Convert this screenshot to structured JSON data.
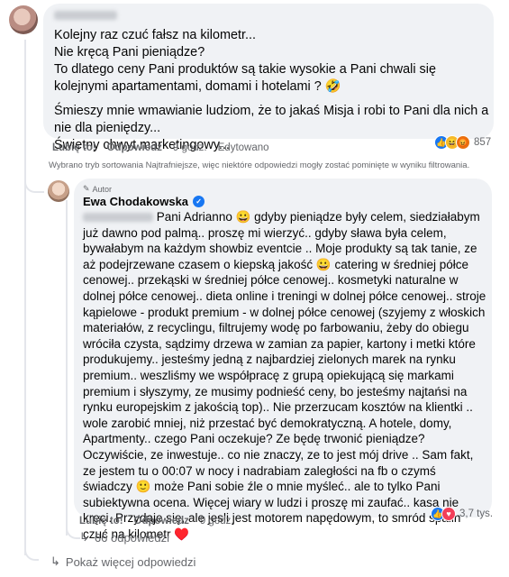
{
  "comment1": {
    "lines": [
      "Kolejny raz czuć fałsz na kilometr...\nNie kręcą Pani pieniądze?\nTo dlatego ceny Pani produktów są takie wysokie a Pani chwali się kolejnymi apartamentami, domami i hotelami ? 🤣",
      "Śmieszy mnie wmawianie ludziom, że to jakaś Misja i robi to Pani dla nich a nie dla pieniędzy...\nŚwietny chwyt marketingowy..."
    ],
    "actions": {
      "like": "Lubię to!",
      "reply": "Odpowiedz",
      "time": "9 godz.",
      "edited": "Edytowano"
    },
    "reaction_count": "857"
  },
  "notice": "Wybrano tryb sortowania Najtrafniejsze, więc niektóre odpowiedzi mogły zostać pominięte w wyniku filtrowania.",
  "reply": {
    "badge": "Autor",
    "author": "Ewa Chodakowska",
    "text": "Pani Adrianno 😀 gdyby pieniądze były celem, siedziałabym już dawno pod palmą.. proszę mi wierzyć.. gdyby sława była celem, bywałabym na każdym showbiz eventcie .. Moje produkty są tak tanie, ze aż podejrzewane czasem o kiepską jakość 😀 catering w średniej półce cenowej.. przekąski w średniej półce cenowej.. kosmetyki naturalne w dolnej półce cenowej.. dieta online i treningi w dolnej półce cenowej.. stroje kąpielowe - produkt premium - w dolnej półce cenowej (szyjemy z włoskich materiałów, z recyclingu, filtrujemy wodę po farbowaniu, żeby do obiegu wróciła czysta, sądzimy drzewa w zamian za papier, kartony i metki które produkujemy.. jesteśmy jedną z najbardziej zielonych marek na rynku premium.. weszliśmy we współpracę z grupą opiekującą się markami premium i słyszymy, ze musimy podnieść ceny, bo jesteśmy najtańsi na rynku europejskim z jakością top).. Nie przerzucam kosztów na klientki .. wole zarobić mniej, niż przestać być demokratyczną. A hotele, domy, Apartmenty.. czego Pani oczekuje? Ze będę trwonić pieniądze? Oczywiście, ze inwestuje.. co nie znaczy, ze to jest mój drive .. Sam fakt, ze jestem tu o 00:07 w nocy i nadrabiam zaległości na fb o czymś świadczy 🙂 może Pani sobie źle o mnie myśleć.. ale to tylko Pani subiektywna ocena. Więcej wiary w ludzi i proszę mi zaufać.. kasa nie kręci. Przydaje się, ale jesli jest motorem napędowym, to smród spalin czuć na kilometr ♥️",
    "actions": {
      "like": "Lubię to!",
      "reply": "Odpowiedz",
      "time": "9 godz."
    },
    "reaction_count": "3,7 tys."
  },
  "more_replies": "66 odpowiedzi",
  "show_more": "Pokaż więcej odpowiedzi",
  "icons": {
    "like": "like-icon",
    "haha": "haha-icon",
    "angry": "angry-icon",
    "love": "love-icon",
    "reply_arrow": "reply-arrow-icon"
  }
}
